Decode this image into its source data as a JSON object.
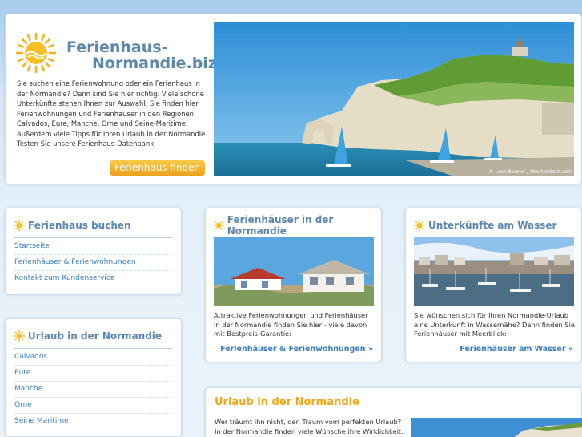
{
  "brand": {
    "line1": "Ferienhaus-",
    "line2": "Normandie.biz"
  },
  "hero": {
    "intro": "Sie suchen eine Ferienwohnung oder ein Ferienhaus in der Normandie? Dann sind Sie hier richtig. Viele schöne Unterkünfte stehen Ihnen zur Auswahl. Sie finden hier Ferienwohnungen und Ferienhäuser in den Regionen Calvados, Eure, Manche, Orne und Seine-Maritime. Außerdem viele Tipps für Ihren Urlaub in der Normandie. Testen Sie unsere Ferienhaus-Datenbank:",
    "cta_label": "Ferienhaus finden",
    "photo_credit": "© Leon Beuner / Shutterstock.com"
  },
  "nav_buchen": {
    "title": "Ferienhaus buchen",
    "items": [
      "Startseite",
      "Ferienhäuser & Ferienwohnungen",
      "Kontakt zum Kundenservice"
    ]
  },
  "nav_urlaub": {
    "title": "Urlaub in der Normandie",
    "items": [
      "Calvados",
      "Eure",
      "Manche",
      "Orne",
      "Seine Maritime"
    ]
  },
  "card_normandie": {
    "title": "Ferienhäuser in der Normandie",
    "text": "Attraktive Ferienwohnungen und Ferienhäuser in der Normandie finden Sie hier - viele davon mit Bestpreis-Garantie:",
    "link": "Ferienhäuser & Ferienwohnungen »"
  },
  "card_wasser": {
    "title": "Unterkünfte am Wasser",
    "text": "Sie wünschen sich für Ihren Normandie-Urlaub eine Unterkunft in Wassernähe? Dann finden Sie Ferienhäuser mit Meerblick:",
    "link": "Ferienhäuser am Wasser »"
  },
  "urlaub_panel": {
    "title": "Urlaub in der Normandie",
    "text": "Wer träumt ihn nicht, den Traum vom perfekten Urlaub? In der Normandie finden viele Wünsche ihre Wirklichkeit."
  },
  "colors": {
    "accent_blue": "#5b86ad",
    "link_blue": "#3a7fc1",
    "cta_orange": "#eba21b",
    "heading_orange": "#f0a81a"
  },
  "icons": [
    "sun-logo-icon",
    "sun-icon"
  ]
}
